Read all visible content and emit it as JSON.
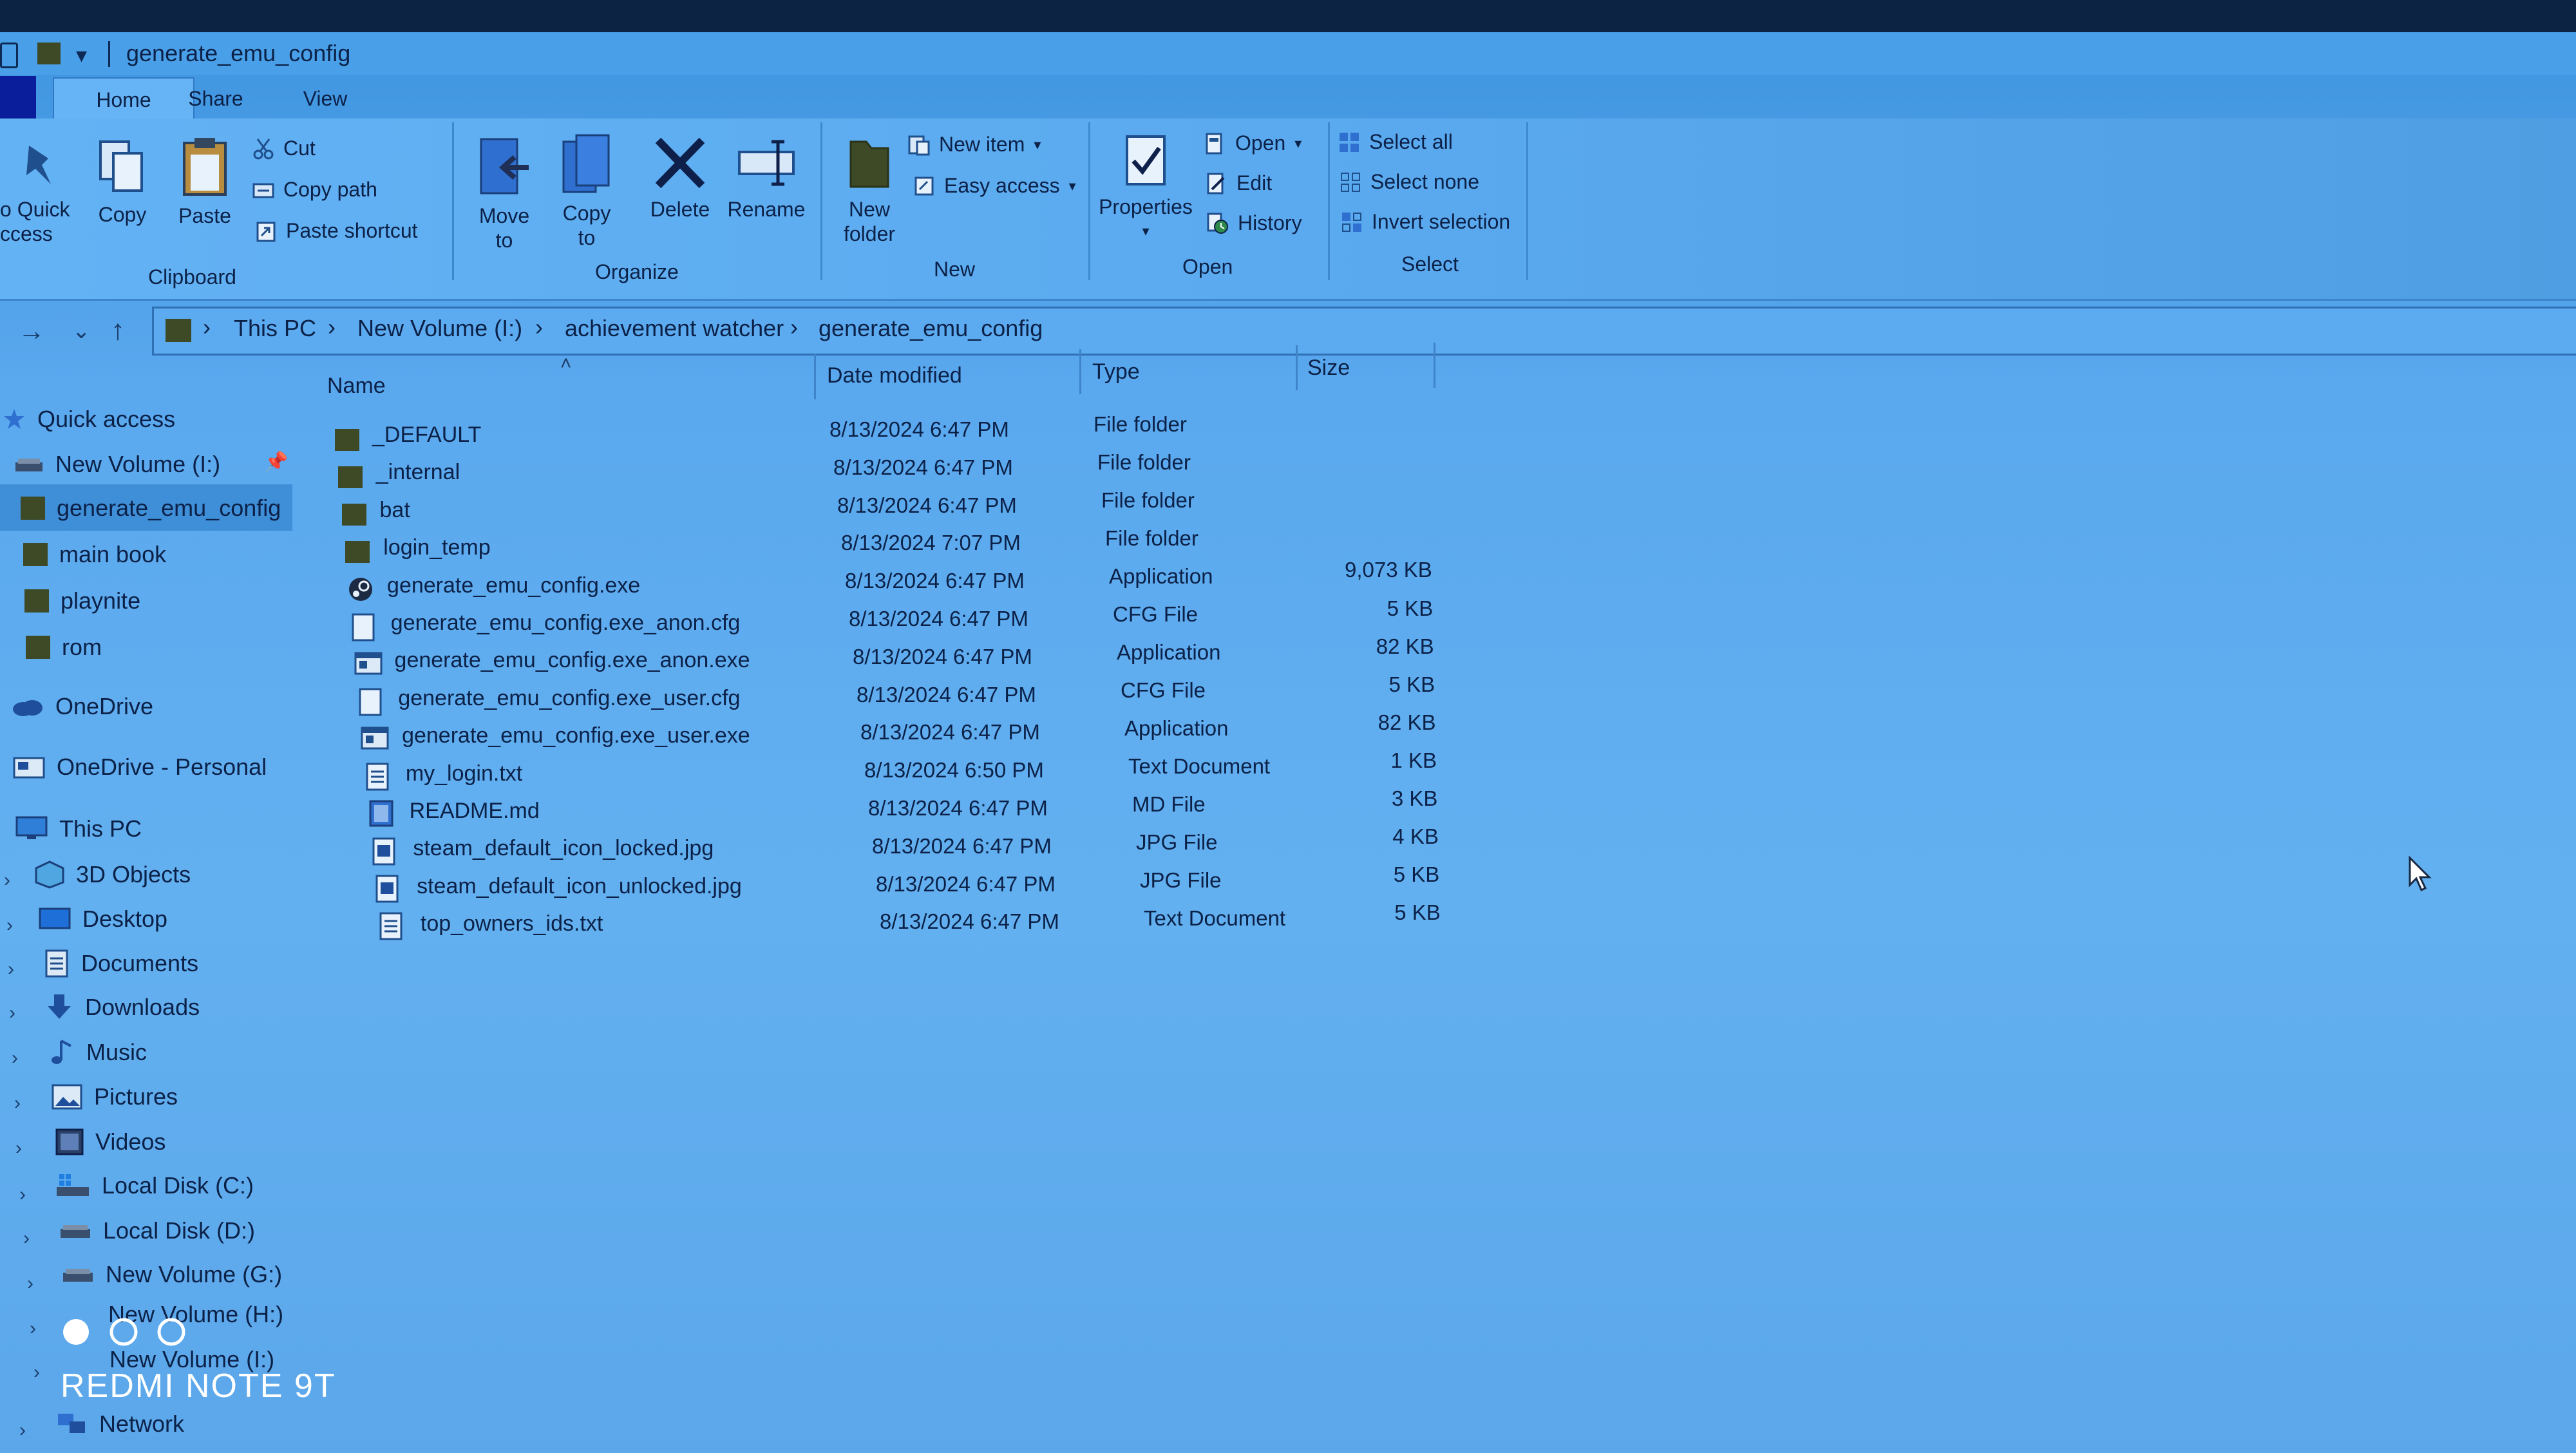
{
  "window": {
    "title": "generate_emu_config"
  },
  "ribbon": {
    "tabs": [
      {
        "label": "Home"
      },
      {
        "label": "Share"
      },
      {
        "label": "View"
      }
    ],
    "clipboard": {
      "label": "Clipboard",
      "pin_label_line1": "o Quick",
      "pin_label_line2": "ccess",
      "copy": "Copy",
      "paste": "Paste",
      "cut": "Cut",
      "copy_path": "Copy path",
      "paste_shortcut": "Paste shortcut"
    },
    "organize": {
      "label": "Organize",
      "move_to_line1": "Move",
      "move_to_line2": "to",
      "copy_to_line1": "Copy",
      "copy_to_line2": "to",
      "delete": "Delete",
      "rename": "Rename"
    },
    "new": {
      "label": "New",
      "new_folder_line1": "New",
      "new_folder_line2": "folder",
      "new_item": "New item",
      "easy_access": "Easy access"
    },
    "open": {
      "label": "Open",
      "properties": "Properties",
      "open": "Open",
      "edit": "Edit",
      "history": "History"
    },
    "select": {
      "label": "Select",
      "select_all": "Select all",
      "select_none": "Select none",
      "invert_selection": "Invert selection"
    }
  },
  "address": {
    "crumbs": [
      "This PC",
      "New Volume (I:)",
      "achievement watcher",
      "generate_emu_config"
    ]
  },
  "nav_pane": {
    "quick_access": "Quick access",
    "pinned": [
      "New Volume (I:)",
      "generate_emu_config",
      "main book",
      "playnite",
      "rom"
    ],
    "onedrive": "OneDrive",
    "onedrive_personal": "OneDrive - Personal",
    "this_pc": "This PC",
    "pc_items": [
      "3D Objects",
      "Desktop",
      "Documents",
      "Downloads",
      "Music",
      "Pictures",
      "Videos",
      "Local Disk (C:)",
      "Local Disk (D:)",
      "New Volume (G:)",
      "New Volume (H:)",
      "New Volume (I:)"
    ],
    "network": "Network"
  },
  "list": {
    "columns": {
      "name": "Name",
      "date": "Date modified",
      "type": "Type",
      "size": "Size"
    },
    "rows": [
      {
        "name": "_DEFAULT",
        "date": "8/13/2024 6:47 PM",
        "type": "File folder",
        "size": "",
        "icon": "folder-icon"
      },
      {
        "name": "_internal",
        "date": "8/13/2024 6:47 PM",
        "type": "File folder",
        "size": "",
        "icon": "folder-icon"
      },
      {
        "name": "bat",
        "date": "8/13/2024 6:47 PM",
        "type": "File folder",
        "size": "",
        "icon": "folder-icon"
      },
      {
        "name": "login_temp",
        "date": "8/13/2024 7:07 PM",
        "type": "File folder",
        "size": "",
        "icon": "folder-icon"
      },
      {
        "name": "generate_emu_config.exe",
        "date": "8/13/2024 6:47 PM",
        "type": "Application",
        "size": "9,073 KB",
        "icon": "steam-icon"
      },
      {
        "name": "generate_emu_config.exe_anon.cfg",
        "date": "8/13/2024 6:47 PM",
        "type": "CFG File",
        "size": "5 KB",
        "icon": "file-icon"
      },
      {
        "name": "generate_emu_config.exe_anon.exe",
        "date": "8/13/2024 6:47 PM",
        "type": "Application",
        "size": "82 KB",
        "icon": "app-icon"
      },
      {
        "name": "generate_emu_config.exe_user.cfg",
        "date": "8/13/2024 6:47 PM",
        "type": "CFG File",
        "size": "5 KB",
        "icon": "file-icon"
      },
      {
        "name": "generate_emu_config.exe_user.exe",
        "date": "8/13/2024 6:47 PM",
        "type": "Application",
        "size": "82 KB",
        "icon": "app-icon"
      },
      {
        "name": "my_login.txt",
        "date": "8/13/2024 6:50 PM",
        "type": "Text Document",
        "size": "1 KB",
        "icon": "text-file-icon"
      },
      {
        "name": "README.md",
        "date": "8/13/2024 6:47 PM",
        "type": "MD File",
        "size": "3 KB",
        "icon": "md-file-icon"
      },
      {
        "name": "steam_default_icon_locked.jpg",
        "date": "8/13/2024 6:47 PM",
        "type": "JPG File",
        "size": "4 KB",
        "icon": "image-file-icon"
      },
      {
        "name": "steam_default_icon_unlocked.jpg",
        "date": "8/13/2024 6:47 PM",
        "type": "JPG File",
        "size": "5 KB",
        "icon": "image-file-icon"
      },
      {
        "name": "top_owners_ids.txt",
        "date": "8/13/2024 6:47 PM",
        "type": "Text Document",
        "size": "5 KB",
        "icon": "text-file-icon"
      }
    ]
  },
  "overlay": {
    "watermark": "REDMI NOTE 9T"
  },
  "colors": {
    "accent": "#3f8fd8",
    "folder": "#3e4a26",
    "text": "#0c2147",
    "file_tab": "#0a1e9c"
  }
}
